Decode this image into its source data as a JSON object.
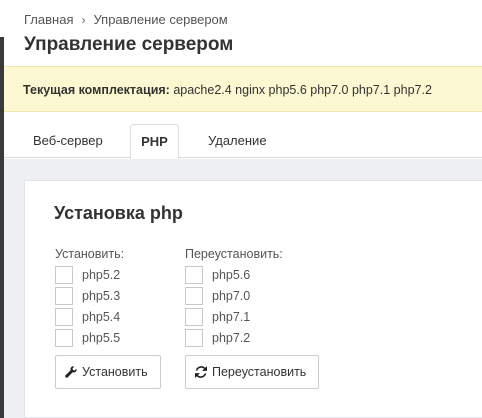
{
  "breadcrumb": {
    "home": "Главная",
    "current": "Управление сервером"
  },
  "page_title": "Управление сервером",
  "alert": {
    "label": "Текущая комплектация:",
    "value": "apache2.4 nginx php5.6 php7.0 php7.1 php7.2"
  },
  "tabs": [
    {
      "label": "Веб-сервер",
      "active": false
    },
    {
      "label": "PHP",
      "active": true
    },
    {
      "label": "Удаление",
      "active": false
    }
  ],
  "panel": {
    "title": "Установка php",
    "install": {
      "label": "Установить:",
      "items": [
        "php5.2",
        "php5.3",
        "php5.4",
        "php5.5"
      ],
      "button": "Установить",
      "icon": "wrench-icon"
    },
    "reinstall": {
      "label": "Переустановить:",
      "items": [
        "php5.6",
        "php7.0",
        "php7.1",
        "php7.2"
      ],
      "button": "Переустановить",
      "icon": "refresh-icon"
    }
  }
}
